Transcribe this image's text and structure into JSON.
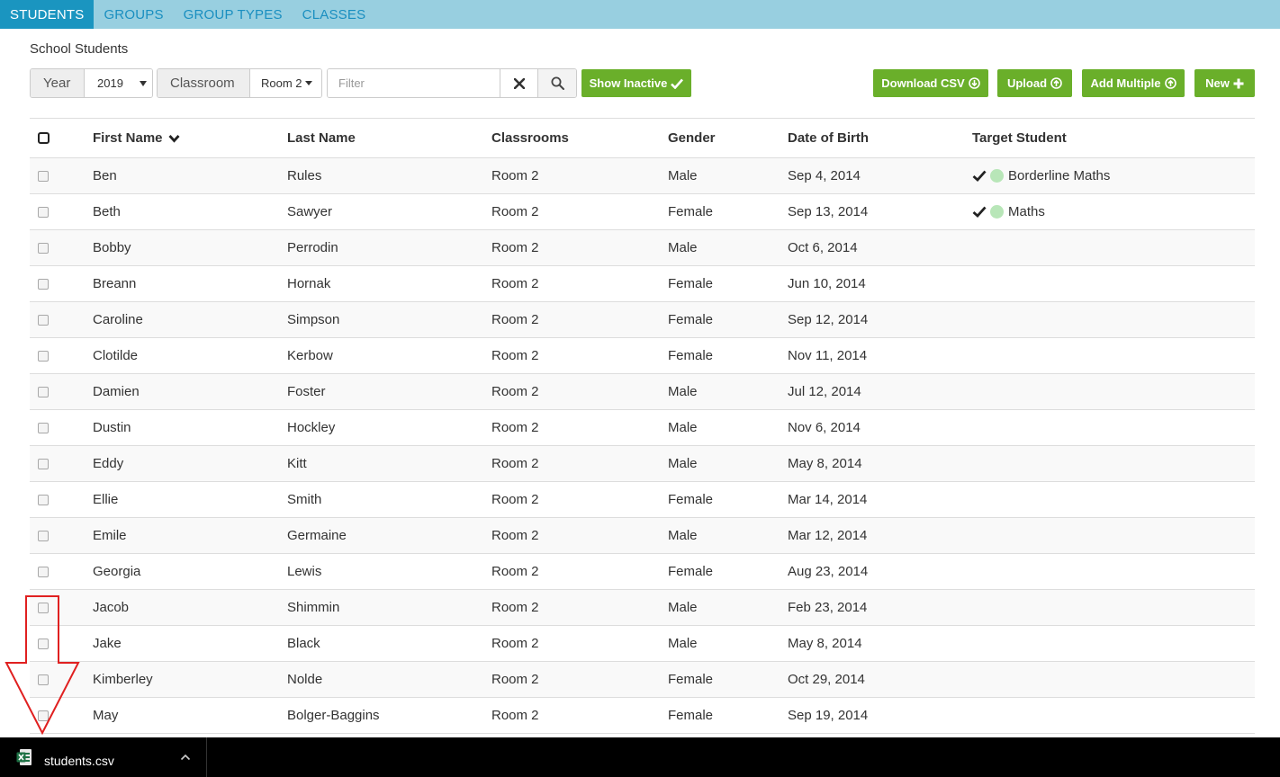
{
  "nav": {
    "tabs": [
      {
        "label": "STUDENTS",
        "active": true
      },
      {
        "label": "GROUPS"
      },
      {
        "label": "GROUP TYPES"
      },
      {
        "label": "CLASSES"
      }
    ]
  },
  "page": {
    "title": "School Students"
  },
  "toolbar": {
    "year_label": "Year",
    "year_value": "2019",
    "classroom_label": "Classroom",
    "classroom_value": "Room 2",
    "filter_placeholder": "Filter",
    "show_inactive_label": "Show Inactive",
    "download_csv_label": "Download CSV",
    "upload_label": "Upload",
    "add_multiple_label": "Add Multiple",
    "new_label": "New"
  },
  "table": {
    "headers": {
      "first_name": "First Name",
      "last_name": "Last Name",
      "classrooms": "Classrooms",
      "gender": "Gender",
      "dob": "Date of Birth",
      "target": "Target Student"
    },
    "rows": [
      {
        "first": "Ben",
        "last": "Rules",
        "classroom": "Room 2",
        "gender": "Male",
        "dob": "Sep 4, 2014",
        "target": "Borderline Maths"
      },
      {
        "first": "Beth",
        "last": "Sawyer",
        "classroom": "Room 2",
        "gender": "Female",
        "dob": "Sep 13, 2014",
        "target": "Maths"
      },
      {
        "first": "Bobby",
        "last": "Perrodin",
        "classroom": "Room 2",
        "gender": "Male",
        "dob": "Oct 6, 2014",
        "target": ""
      },
      {
        "first": "Breann",
        "last": "Hornak",
        "classroom": "Room 2",
        "gender": "Female",
        "dob": "Jun 10, 2014",
        "target": ""
      },
      {
        "first": "Caroline",
        "last": "Simpson",
        "classroom": "Room 2",
        "gender": "Female",
        "dob": "Sep 12, 2014",
        "target": ""
      },
      {
        "first": "Clotilde",
        "last": "Kerbow",
        "classroom": "Room 2",
        "gender": "Female",
        "dob": "Nov 11, 2014",
        "target": ""
      },
      {
        "first": "Damien",
        "last": "Foster",
        "classroom": "Room 2",
        "gender": "Male",
        "dob": "Jul 12, 2014",
        "target": ""
      },
      {
        "first": "Dustin",
        "last": "Hockley",
        "classroom": "Room 2",
        "gender": "Male",
        "dob": "Nov 6, 2014",
        "target": ""
      },
      {
        "first": "Eddy",
        "last": "Kitt",
        "classroom": "Room 2",
        "gender": "Male",
        "dob": "May 8, 2014",
        "target": ""
      },
      {
        "first": "Ellie",
        "last": "Smith",
        "classroom": "Room 2",
        "gender": "Female",
        "dob": "Mar 14, 2014",
        "target": ""
      },
      {
        "first": "Emile",
        "last": "Germaine",
        "classroom": "Room 2",
        "gender": "Male",
        "dob": "Mar 12, 2014",
        "target": ""
      },
      {
        "first": "Georgia",
        "last": "Lewis",
        "classroom": "Room 2",
        "gender": "Female",
        "dob": "Aug 23, 2014",
        "target": ""
      },
      {
        "first": "Jacob",
        "last": "Shimmin",
        "classroom": "Room 2",
        "gender": "Male",
        "dob": "Feb 23, 2014",
        "target": ""
      },
      {
        "first": "Jake",
        "last": "Black",
        "classroom": "Room 2",
        "gender": "Male",
        "dob": "May 8, 2014",
        "target": ""
      },
      {
        "first": "Kimberley",
        "last": "Nolde",
        "classroom": "Room 2",
        "gender": "Female",
        "dob": "Oct 29, 2014",
        "target": ""
      },
      {
        "first": "May",
        "last": "Bolger-Baggins",
        "classroom": "Room 2",
        "gender": "Female",
        "dob": "Sep 19, 2014",
        "target": ""
      }
    ]
  },
  "download_bar": {
    "filename": "students.csv",
    "file_icon": "excel-file-icon"
  },
  "colors": {
    "nav_bg": "#98cfe0",
    "nav_active": "#1a95c0",
    "accent_green": "#6aaf2a",
    "annotation_red": "#e02020"
  }
}
